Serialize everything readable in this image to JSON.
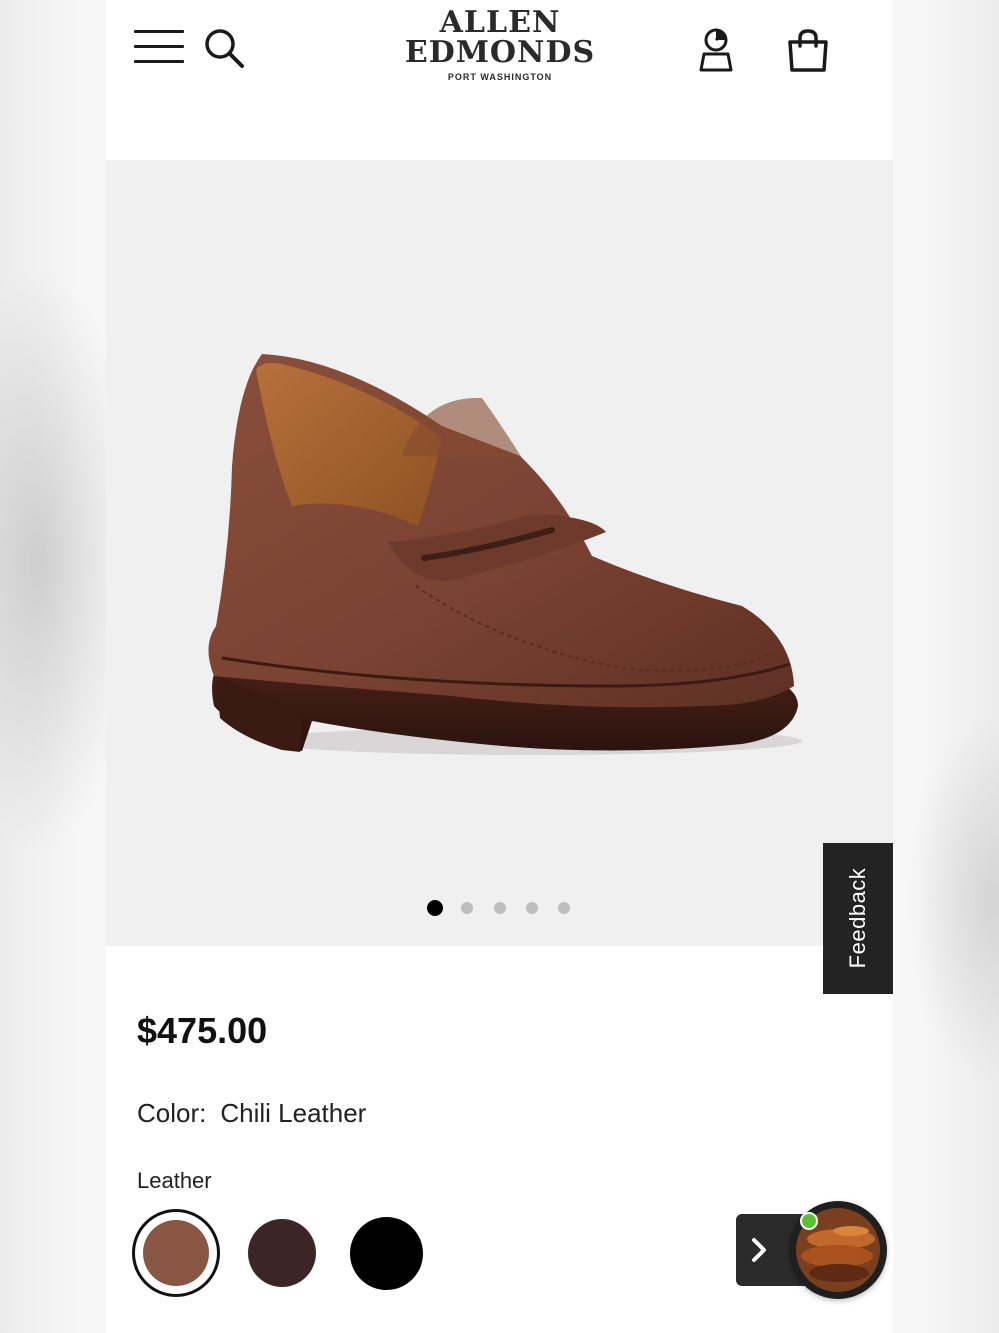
{
  "header": {
    "brand": {
      "line1": "ALLEN",
      "line2": "EDMONDS",
      "tagline": "PORT WASHINGTON"
    },
    "icons": [
      "menu-icon",
      "search-icon",
      "account-icon",
      "shopping-bag-icon"
    ]
  },
  "gallery": {
    "image": "brown penny loafer",
    "slide_count": 5,
    "active_slide": 1
  },
  "feedback": {
    "label": "Feedback"
  },
  "product": {
    "price": "$475.00",
    "color_label": "Color:",
    "color_value": "Chili Leather",
    "material_label": "Leather",
    "swatches": [
      {
        "color": "#8a5644",
        "selected": true
      },
      {
        "color": "#3c2427",
        "selected": false
      },
      {
        "color": "#000000",
        "selected": false
      }
    ]
  },
  "chat": {
    "icons": [
      "chevron-right-icon",
      "chat-avatar"
    ],
    "online": true
  }
}
